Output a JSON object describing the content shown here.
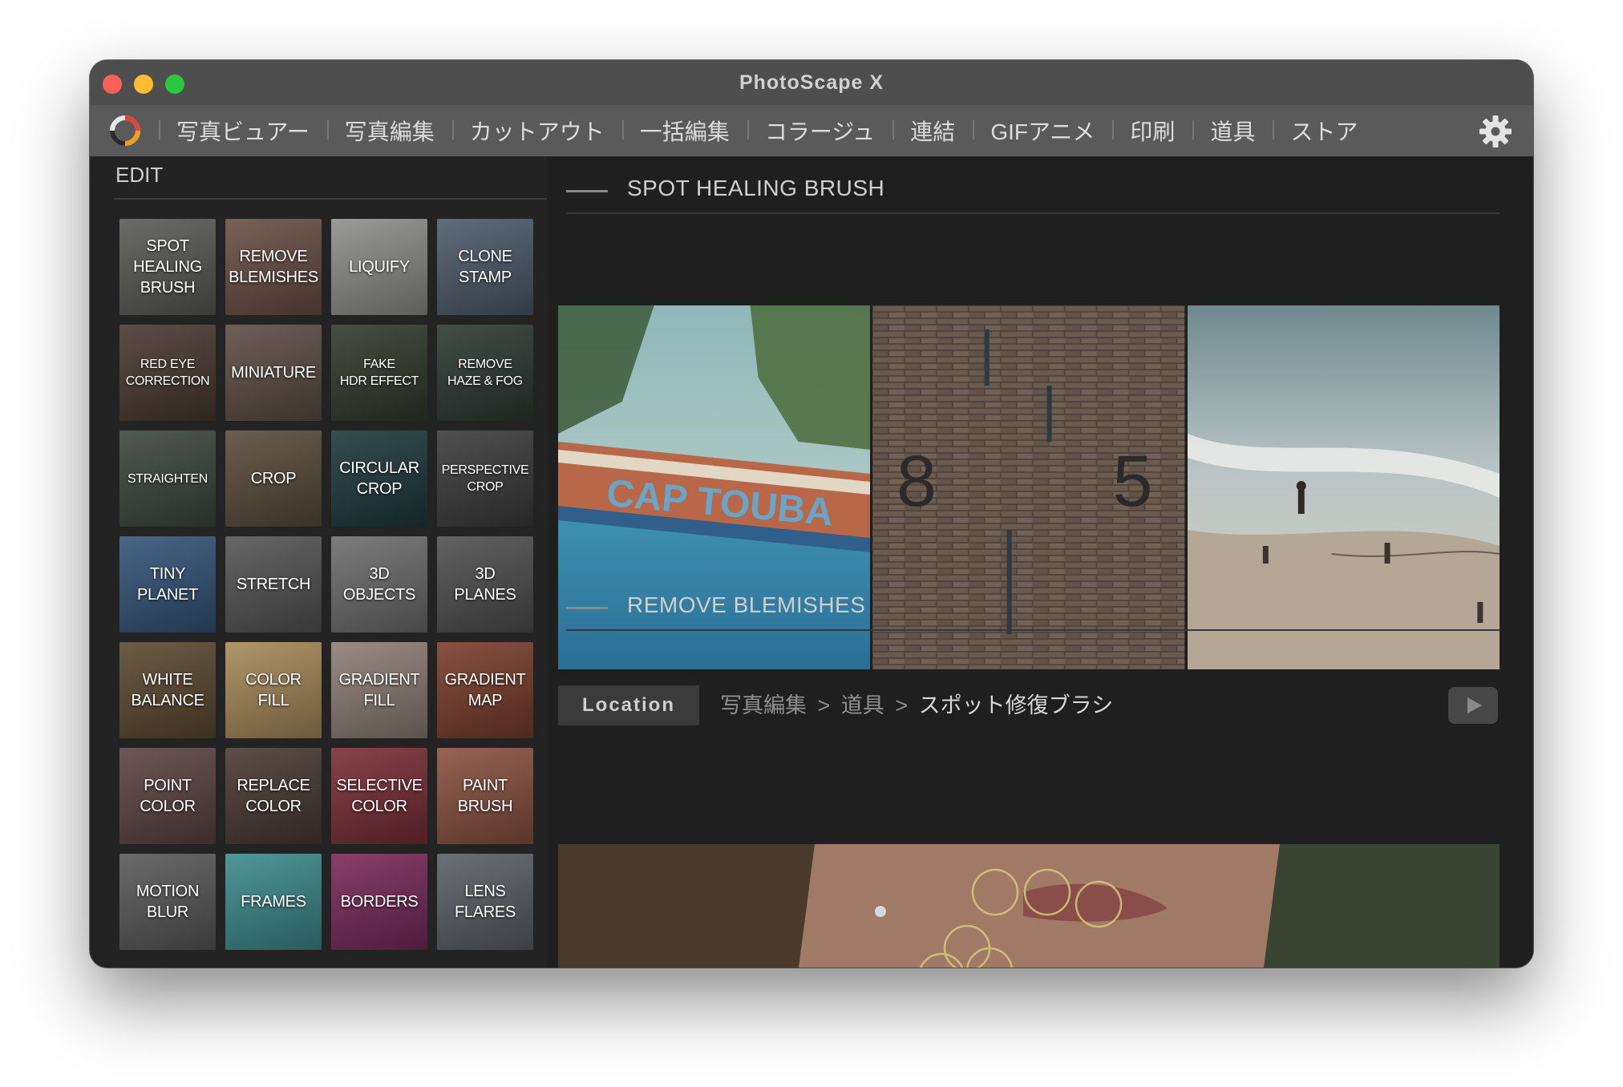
{
  "window": {
    "title": "PhotoScape X"
  },
  "menu": {
    "items": [
      "写真ビュアー",
      "写真編集",
      "カットアウト",
      "一括編集",
      "コラージュ",
      "連結",
      "GIFアニメ",
      "印刷",
      "道具",
      "ストア"
    ],
    "logo_icon": "photoscape-logo-icon",
    "settings_icon": "gear-icon"
  },
  "sidebar": {
    "label": "EDIT",
    "tools": [
      {
        "label": "SPOT\nHEALING\nBRUSH",
        "bg": "#5a5c58"
      },
      {
        "label": "REMOVE\nBLEMISHES",
        "bg": "#6a4f45"
      },
      {
        "label": "LIQUIFY",
        "bg": "#8f8f8d"
      },
      {
        "label": "CLONE\nSTAMP",
        "bg": "#4d5c6b"
      },
      {
        "label": "RED EYE\nCORRECTION",
        "bg": "#4a3a30",
        "small": true
      },
      {
        "label": "MINIATURE",
        "bg": "#5e4e45"
      },
      {
        "label": "FAKE\nHDR EFFECT",
        "bg": "#333a2e",
        "small": true
      },
      {
        "label": "REMOVE\nHAZE & FOG",
        "bg": "#2e3a34",
        "small": true
      },
      {
        "label": "STRAIGHTEN",
        "bg": "#3c4840",
        "small": true
      },
      {
        "label": "CROP",
        "bg": "#5a4c3c"
      },
      {
        "label": "CIRCULAR\nCROP",
        "bg": "#1e3a3d"
      },
      {
        "label": "PERSPECTIVE\nCROP",
        "bg": "#3c3c3c",
        "small": true
      },
      {
        "label": "TINY\nPLANET",
        "bg": "#34557a"
      },
      {
        "label": "STRETCH",
        "bg": "#555555"
      },
      {
        "label": "3D\nOBJECTS",
        "bg": "#6e6e6e"
      },
      {
        "label": "3D\nPLANES",
        "bg": "#505050"
      },
      {
        "label": "WHITE\nBALANCE",
        "bg": "#5c4a30"
      },
      {
        "label": "COLOR\nFILL",
        "bg": "#a88a5a"
      },
      {
        "label": "GRADIENT\nFILL",
        "bg": "#8e7f76"
      },
      {
        "label": "GRADIENT\nMAP",
        "bg": "#7a3e2c"
      },
      {
        "label": "POINT\nCOLOR",
        "bg": "#5d4444"
      },
      {
        "label": "REPLACE\nCOLOR",
        "bg": "#4a3a34"
      },
      {
        "label": "SELECTIVE\nCOLOR",
        "bg": "#7a2e36"
      },
      {
        "label": "PAINT\nBRUSH",
        "bg": "#8a5240"
      },
      {
        "label": "MOTION\nBLUR",
        "bg": "#5a5a5a"
      },
      {
        "label": "FRAMES",
        "bg": "#3d8b8e"
      },
      {
        "label": "BORDERS",
        "bg": "#7a2a5a"
      },
      {
        "label": "LENS\nFLARES",
        "bg": "#5c6066"
      }
    ]
  },
  "section1": {
    "title": "SPOT HEALING BRUSH",
    "location_label": "Location",
    "path_1": "写真編集",
    "path_2": "道具",
    "path_3": "スポット修復ブラシ",
    "separator": ">"
  },
  "section2": {
    "title": "REMOVE BLEMISHES"
  },
  "colors": {
    "window_bg": "#1f1f1f",
    "menubar_bg": "#5a5a5a",
    "titlebar_bg": "#4e4e4e"
  }
}
